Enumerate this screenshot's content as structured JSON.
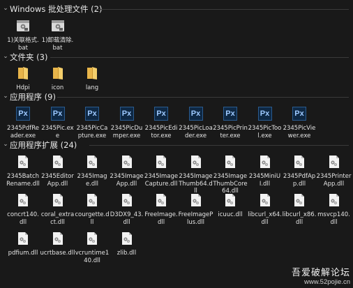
{
  "groups": {
    "bat": {
      "title": "Windows 批处理文件 (2)",
      "items": [
        {
          "label": "1)关联格式.bat",
          "icon": "bat-file-icon"
        },
        {
          "label": "1)卸载清除.bat",
          "icon": "bat-file-icon"
        }
      ]
    },
    "folders": {
      "title": "文件夹 (3)",
      "items": [
        {
          "label": "Hdpi",
          "icon": "folder-icon"
        },
        {
          "label": "icon",
          "icon": "folder-icon"
        },
        {
          "label": "lang",
          "icon": "folder-icon"
        }
      ]
    },
    "apps": {
      "title": "应用程序 (9)",
      "items": [
        {
          "label": "2345PdfReader.exe",
          "icon": "px-app-icon"
        },
        {
          "label": "2345Pic.exe",
          "icon": "px-app-icon"
        },
        {
          "label": "2345PicCapture.exe",
          "icon": "px-app-icon"
        },
        {
          "label": "2345PicDumper.exe",
          "icon": "px-app-icon"
        },
        {
          "label": "2345PicEditor.exe",
          "icon": "px-app-icon"
        },
        {
          "label": "2345PicLoader.exe",
          "icon": "px-app-icon"
        },
        {
          "label": "2345PicPrinter.exe",
          "icon": "px-app-icon"
        },
        {
          "label": "2345PicTool.exe",
          "icon": "px-app-icon"
        },
        {
          "label": "2345PicViewer.exe",
          "icon": "px-app-icon"
        }
      ]
    },
    "dlls": {
      "title": "应用程序扩展 (24)",
      "items": [
        {
          "label": "2345BatchRename.dll",
          "icon": "dll-file-icon"
        },
        {
          "label": "2345EditorApp.dll",
          "icon": "dll-file-icon"
        },
        {
          "label": "2345Image.dll",
          "icon": "dll-file-icon"
        },
        {
          "label": "2345ImageApp.dll",
          "icon": "dll-file-icon"
        },
        {
          "label": "2345ImageCapture.dll",
          "icon": "dll-file-icon"
        },
        {
          "label": "2345ImageThumb64.dll",
          "icon": "dll-file-icon"
        },
        {
          "label": "2345ImageThumbCore64.dll",
          "icon": "dll-file-icon"
        },
        {
          "label": "2345MiniUI.dll",
          "icon": "dll-file-icon"
        },
        {
          "label": "2345PdfApp.dll",
          "icon": "dll-file-icon"
        },
        {
          "label": "2345PrinterApp.dll",
          "icon": "dll-file-icon"
        },
        {
          "label": "concrt140.dll",
          "icon": "dll-file-icon"
        },
        {
          "label": "coral_extract.dll",
          "icon": "dll-file-icon"
        },
        {
          "label": "courgette.dll",
          "icon": "dll-file-icon"
        },
        {
          "label": "D3DX9_43.dll",
          "icon": "dll-file-icon"
        },
        {
          "label": "FreeImage.dll",
          "icon": "dll-file-icon"
        },
        {
          "label": "FreeImagePlus.dll",
          "icon": "dll-file-icon"
        },
        {
          "label": "icuuc.dll",
          "icon": "dll-file-icon"
        },
        {
          "label": "libcurl_x64.dll",
          "icon": "dll-file-icon"
        },
        {
          "label": "libcurl_x86.dll",
          "icon": "dll-file-icon"
        },
        {
          "label": "msvcp140.dll",
          "icon": "dll-file-icon"
        },
        {
          "label": "pdfium.dll",
          "icon": "dll-file-icon"
        },
        {
          "label": "ucrtbase.dll",
          "icon": "dll-file-icon"
        },
        {
          "label": "vcruntime140.dll",
          "icon": "dll-file-icon"
        },
        {
          "label": "zlib.dll",
          "icon": "dll-file-icon"
        }
      ]
    }
  },
  "watermark": {
    "line1": "吾爱破解论坛",
    "line2": "www.52pojie.cn"
  }
}
